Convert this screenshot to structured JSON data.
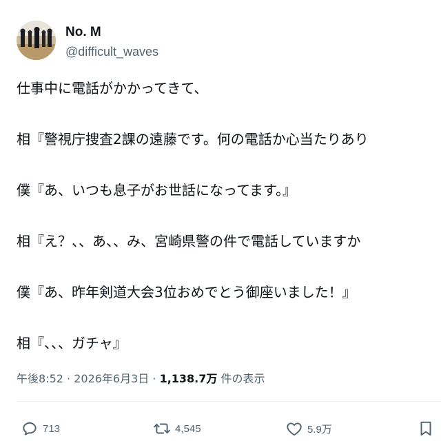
{
  "author": {
    "display_name": "No. M",
    "handle": "@difficult_waves",
    "avatar_icon": "kendo-dojo-avatar"
  },
  "tweet": {
    "lines": [
      "仕事中に電話がかかってきて、",
      "相『警視庁捜査2課の遠藤です。何の電話か心当たりあり",
      "僕『あ、いつも息子がお世話になってます。』",
      "相『え？、、あ、、み、宮崎県警の件で電話していますか",
      "僕『あ、昨年剣道大会3位おめでとう御座いました！』",
      "相『、、、ガチャ』"
    ]
  },
  "meta": {
    "time": "午後8:52",
    "separator": " · ",
    "date": "2026年6月3日",
    "views_count": "1,138.7万",
    "views_label": " 件の表示"
  },
  "actions": {
    "reply_count": "713",
    "retweet_count": "4,545",
    "like_count": "5.9万"
  },
  "colors": {
    "text": "#0f1419",
    "secondary": "#536471",
    "divider": "#eff3f4"
  }
}
